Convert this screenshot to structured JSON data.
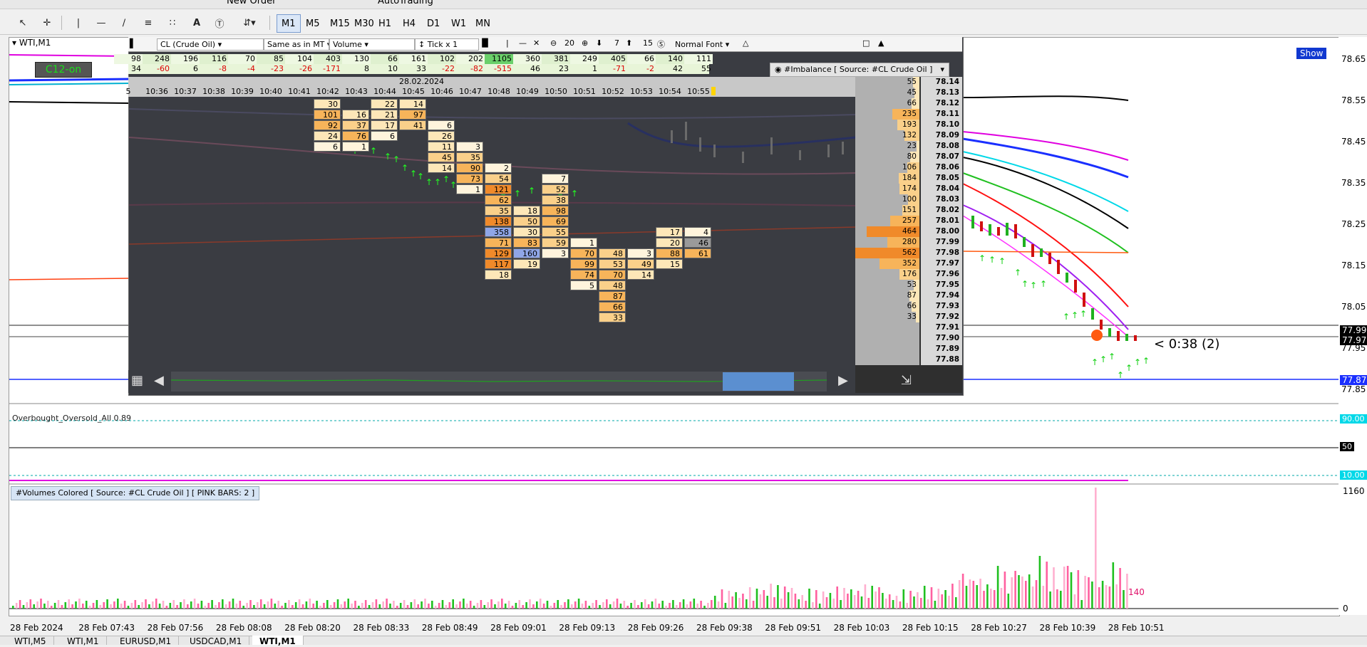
{
  "toolbar": {
    "new_order_label": "New Order",
    "autotrading_label": "AutoTrading",
    "timeframes": [
      "M1",
      "M5",
      "M15",
      "M30",
      "H1",
      "H4",
      "D1",
      "W1",
      "MN"
    ],
    "active_timeframe": "M1"
  },
  "chart": {
    "title": "WTI,M1",
    "c12_label": "C12-on",
    "show_button": "Show",
    "timer_label": "< 0:38 (2)",
    "price_axis": [
      "78.65",
      "78.55",
      "78.45",
      "78.35",
      "78.25",
      "78.15",
      "78.05",
      "77.95",
      "77.85"
    ],
    "current_price_bid": "77.99",
    "current_price_ask": "77.97",
    "blue_line_price": "77.87",
    "time_axis": [
      "28 Feb 2024",
      "28 Feb 07:43",
      "28 Feb 07:56",
      "28 Feb 08:08",
      "28 Feb 08:20",
      "28 Feb 08:33",
      "28 Feb 08:49",
      "28 Feb 09:01",
      "28 Feb 09:13",
      "28 Feb 09:26",
      "28 Feb 09:38",
      "28 Feb 09:51",
      "28 Feb 10:03",
      "28 Feb 10:15",
      "28 Feb 10:27",
      "28 Feb 10:39",
      "28 Feb 10:51"
    ]
  },
  "footprint": {
    "symbol_select": "CL (Crude Oil)",
    "tz_select": "Same as in MT",
    "mode_select": "Volume",
    "tick_label": "Tick x 1",
    "num1": "20",
    "num2": "7",
    "num3": "15",
    "font_select": "Normal Font",
    "date_label": "28.02.2024",
    "imbalance_label": "#Imbalance [ Source: #CL Crude Oil ]",
    "row_volume": [
      "98",
      "248",
      "196",
      "116",
      "70",
      "85",
      "104",
      "403",
      "130",
      "66",
      "161",
      "102",
      "202",
      "1105",
      "360",
      "381",
      "249",
      "405",
      "66",
      "140",
      "111"
    ],
    "row_delta": [
      "34",
      "-60",
      "6",
      "-8",
      "-4",
      "-23",
      "-26",
      "-171",
      "8",
      "10",
      "33",
      "-22",
      "-82",
      "-515",
      "46",
      "23",
      "1",
      "-71",
      "-2",
      "42",
      "55"
    ],
    "times": [
      "5",
      "10:36",
      "10:37",
      "10:38",
      "10:39",
      "10:40",
      "10:41",
      "10:42",
      "10:43",
      "10:44",
      "10:45",
      "10:46",
      "10:47",
      "10:48",
      "10:49",
      "10:50",
      "10:51",
      "10:52",
      "10:53",
      "10:54",
      "10:55"
    ],
    "cells": [
      {
        "col": 7,
        "row": 0,
        "v": "30",
        "c": "#fde7b8"
      },
      {
        "col": 7,
        "row": 1,
        "v": "101",
        "c": "#f7b45a"
      },
      {
        "col": 7,
        "row": 2,
        "v": "92",
        "c": "#f7b45a"
      },
      {
        "col": 7,
        "row": 3,
        "v": "24",
        "c": "#fde7b8"
      },
      {
        "col": 7,
        "row": 4,
        "v": "6",
        "c": "#fff4dc"
      },
      {
        "col": 8,
        "row": 1,
        "v": "16",
        "c": "#fde7b8"
      },
      {
        "col": 8,
        "row": 2,
        "v": "37",
        "c": "#fad08a"
      },
      {
        "col": 8,
        "row": 3,
        "v": "76",
        "c": "#f7b45a"
      },
      {
        "col": 8,
        "row": 4,
        "v": "1",
        "c": "#fff4dc"
      },
      {
        "col": 9,
        "row": 0,
        "v": "22",
        "c": "#fde7b8"
      },
      {
        "col": 9,
        "row": 1,
        "v": "21",
        "c": "#fde7b8"
      },
      {
        "col": 9,
        "row": 2,
        "v": "17",
        "c": "#fde7b8"
      },
      {
        "col": 9,
        "row": 3,
        "v": "6",
        "c": "#fff4dc"
      },
      {
        "col": 10,
        "row": 0,
        "v": "14",
        "c": "#fde7b8"
      },
      {
        "col": 10,
        "row": 1,
        "v": "97",
        "c": "#f7b45a"
      },
      {
        "col": 10,
        "row": 2,
        "v": "41",
        "c": "#fad08a"
      },
      {
        "col": 11,
        "row": 2,
        "v": "6",
        "c": "#fff4dc"
      },
      {
        "col": 11,
        "row": 3,
        "v": "26",
        "c": "#fde7b8"
      },
      {
        "col": 11,
        "row": 4,
        "v": "11",
        "c": "#fde7b8"
      },
      {
        "col": 11,
        "row": 5,
        "v": "45",
        "c": "#fad08a"
      },
      {
        "col": 11,
        "row": 6,
        "v": "14",
        "c": "#fde7b8"
      },
      {
        "col": 12,
        "row": 4,
        "v": "3",
        "c": "#fff4dc"
      },
      {
        "col": 12,
        "row": 5,
        "v": "35",
        "c": "#fad08a"
      },
      {
        "col": 12,
        "row": 6,
        "v": "90",
        "c": "#f7b45a"
      },
      {
        "col": 12,
        "row": 7,
        "v": "73",
        "c": "#f7b45a"
      },
      {
        "col": 12,
        "row": 8,
        "v": "1",
        "c": "#fff4dc"
      },
      {
        "col": 13,
        "row": 6,
        "v": "2",
        "c": "#fff4dc"
      },
      {
        "col": 13,
        "row": 7,
        "v": "54",
        "c": "#fad08a"
      },
      {
        "col": 13,
        "row": 8,
        "v": "121",
        "c": "#f08a2a"
      },
      {
        "col": 13,
        "row": 9,
        "v": "62",
        "c": "#f7b45a"
      },
      {
        "col": 13,
        "row": 10,
        "v": "35",
        "c": "#fad08a"
      },
      {
        "col": 13,
        "row": 11,
        "v": "138",
        "c": "#f08a2a"
      },
      {
        "col": 13,
        "row": 12,
        "v": "358",
        "c": "#8fa6e8"
      },
      {
        "col": 13,
        "row": 13,
        "v": "71",
        "c": "#f7b45a"
      },
      {
        "col": 13,
        "row": 14,
        "v": "129",
        "c": "#f08a2a"
      },
      {
        "col": 13,
        "row": 15,
        "v": "117",
        "c": "#f08a2a"
      },
      {
        "col": 13,
        "row": 16,
        "v": "18",
        "c": "#fde7b8"
      },
      {
        "col": 14,
        "row": 10,
        "v": "18",
        "c": "#fde7b8"
      },
      {
        "col": 14,
        "row": 11,
        "v": "50",
        "c": "#fad08a"
      },
      {
        "col": 14,
        "row": 12,
        "v": "30",
        "c": "#fde7b8"
      },
      {
        "col": 14,
        "row": 13,
        "v": "83",
        "c": "#f7b45a"
      },
      {
        "col": 14,
        "row": 14,
        "v": "160",
        "c": "#8fa6e8"
      },
      {
        "col": 14,
        "row": 15,
        "v": "19",
        "c": "#fde7b8"
      },
      {
        "col": 15,
        "row": 7,
        "v": "7",
        "c": "#fff4dc"
      },
      {
        "col": 15,
        "row": 8,
        "v": "52",
        "c": "#fad08a"
      },
      {
        "col": 15,
        "row": 9,
        "v": "38",
        "c": "#fad08a"
      },
      {
        "col": 15,
        "row": 10,
        "v": "98",
        "c": "#f7b45a"
      },
      {
        "col": 15,
        "row": 11,
        "v": "69",
        "c": "#f7b45a"
      },
      {
        "col": 15,
        "row": 12,
        "v": "55",
        "c": "#fad08a"
      },
      {
        "col": 15,
        "row": 13,
        "v": "59",
        "c": "#fad08a"
      },
      {
        "col": 15,
        "row": 14,
        "v": "3",
        "c": "#fff4dc"
      },
      {
        "col": 16,
        "row": 13,
        "v": "1",
        "c": "#fff4dc"
      },
      {
        "col": 16,
        "row": 14,
        "v": "70",
        "c": "#f7b45a"
      },
      {
        "col": 16,
        "row": 15,
        "v": "99",
        "c": "#f7b45a"
      },
      {
        "col": 16,
        "row": 16,
        "v": "74",
        "c": "#f7b45a"
      },
      {
        "col": 16,
        "row": 17,
        "v": "5",
        "c": "#fff4dc"
      },
      {
        "col": 17,
        "row": 14,
        "v": "48",
        "c": "#fad08a"
      },
      {
        "col": 17,
        "row": 15,
        "v": "53",
        "c": "#fad08a"
      },
      {
        "col": 17,
        "row": 16,
        "v": "70",
        "c": "#f7b45a"
      },
      {
        "col": 17,
        "row": 17,
        "v": "48",
        "c": "#fad08a"
      },
      {
        "col": 17,
        "row": 18,
        "v": "87",
        "c": "#f7b45a"
      },
      {
        "col": 17,
        "row": 19,
        "v": "66",
        "c": "#f7b45a"
      },
      {
        "col": 17,
        "row": 20,
        "v": "33",
        "c": "#fad08a"
      },
      {
        "col": 18,
        "row": 14,
        "v": "3",
        "c": "#fff4dc"
      },
      {
        "col": 18,
        "row": 15,
        "v": "49",
        "c": "#fad08a"
      },
      {
        "col": 18,
        "row": 16,
        "v": "14",
        "c": "#fde7b8"
      },
      {
        "col": 19,
        "row": 12,
        "v": "17",
        "c": "#fde7b8"
      },
      {
        "col": 19,
        "row": 13,
        "v": "20",
        "c": "#fde7b8"
      },
      {
        "col": 19,
        "row": 14,
        "v": "88",
        "c": "#f7b45a"
      },
      {
        "col": 19,
        "row": 15,
        "v": "15",
        "c": "#fde7b8"
      },
      {
        "col": 20,
        "row": 12,
        "v": "4",
        "c": "#fff4dc"
      },
      {
        "col": 20,
        "row": 13,
        "v": "46",
        "c": "#9a9a9a"
      },
      {
        "col": 20,
        "row": 14,
        "v": "61",
        "c": "#f7b45a"
      }
    ],
    "ladder": [
      {
        "vol": "55",
        "price": "78.14"
      },
      {
        "vol": "45",
        "price": "78.13"
      },
      {
        "vol": "66",
        "price": "78.12"
      },
      {
        "vol": "235",
        "price": "78.11"
      },
      {
        "vol": "193",
        "price": "78.10"
      },
      {
        "vol": "132",
        "price": "78.09"
      },
      {
        "vol": "23",
        "price": "78.08"
      },
      {
        "vol": "80",
        "price": "78.07"
      },
      {
        "vol": "106",
        "price": "78.06"
      },
      {
        "vol": "184",
        "price": "78.05"
      },
      {
        "vol": "174",
        "price": "78.04"
      },
      {
        "vol": "100",
        "price": "78.03"
      },
      {
        "vol": "151",
        "price": "78.02"
      },
      {
        "vol": "257",
        "price": "78.01"
      },
      {
        "vol": "464",
        "price": "78.00"
      },
      {
        "vol": "280",
        "price": "77.99"
      },
      {
        "vol": "562",
        "price": "77.98"
      },
      {
        "vol": "352",
        "price": "77.97"
      },
      {
        "vol": "176",
        "price": "77.96"
      },
      {
        "vol": "53",
        "price": "77.95"
      },
      {
        "vol": "87",
        "price": "77.94"
      },
      {
        "vol": "66",
        "price": "77.93"
      },
      {
        "vol": "33",
        "price": "77.92"
      },
      {
        "vol": "",
        "price": "77.91"
      },
      {
        "vol": "",
        "price": "77.90"
      },
      {
        "vol": "",
        "price": "77.89"
      },
      {
        "vol": "",
        "price": "77.88"
      }
    ]
  },
  "indicators": {
    "obos_label": "Overbought_Oversold_All 0.89",
    "obos_levels": [
      "90.00",
      "50",
      "10.00"
    ],
    "volumes_label": "#Volumes Colored [ Source: #CL Crude Oil ]  [ PINK BARS: 2 ]",
    "vol_axis": [
      "1160",
      "0"
    ],
    "last_volume_label": "140"
  },
  "tabs": [
    "WTI,M5",
    "WTI,M1",
    "EURUSD,M1",
    "USDCAD,M1",
    "WTI,M1"
  ],
  "active_tab_index": 4
}
